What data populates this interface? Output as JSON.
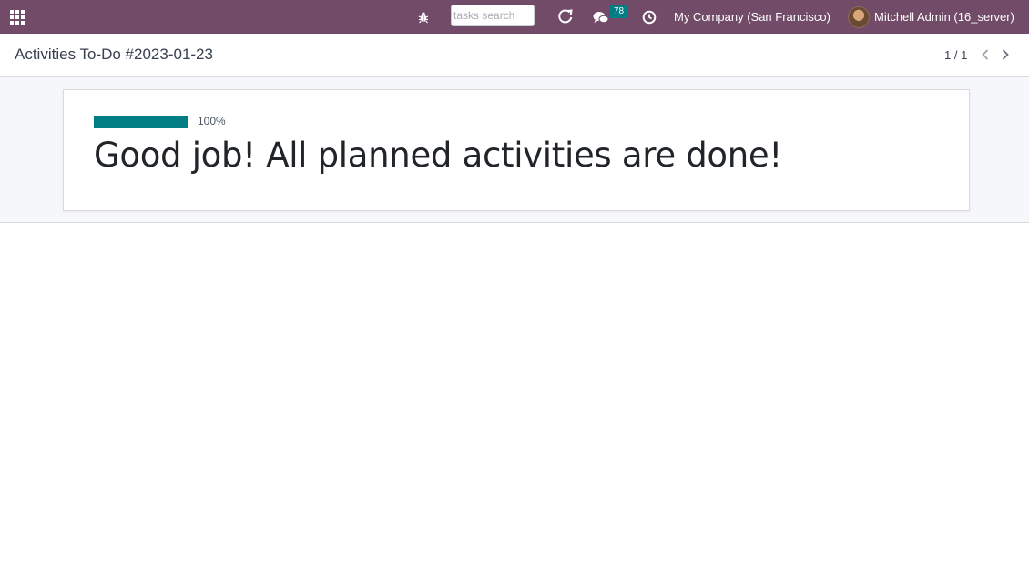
{
  "navbar": {
    "apps_icon": "grid-icon",
    "debug_icon": "bug-icon",
    "search": {
      "placeholder": "tasks search",
      "value": ""
    },
    "refresh_icon": "refresh-icon",
    "messages": {
      "icon": "chat-icon",
      "count": "78"
    },
    "activities_icon": "clock-icon",
    "company": "My Company (San Francisco)",
    "user": "Mitchell Admin (16_server)",
    "colors": {
      "brand": "#714b67",
      "badge": "#017e84"
    }
  },
  "control_panel": {
    "breadcrumb": "Activities To-Do #2023-01-23",
    "pager": "1 / 1",
    "prev_icon": "chevron-left-icon",
    "next_icon": "chevron-right-icon"
  },
  "main": {
    "progress": {
      "value": 100,
      "label": "100%",
      "color": "#017e84"
    },
    "headline": "Good job! All planned activities are done!"
  }
}
